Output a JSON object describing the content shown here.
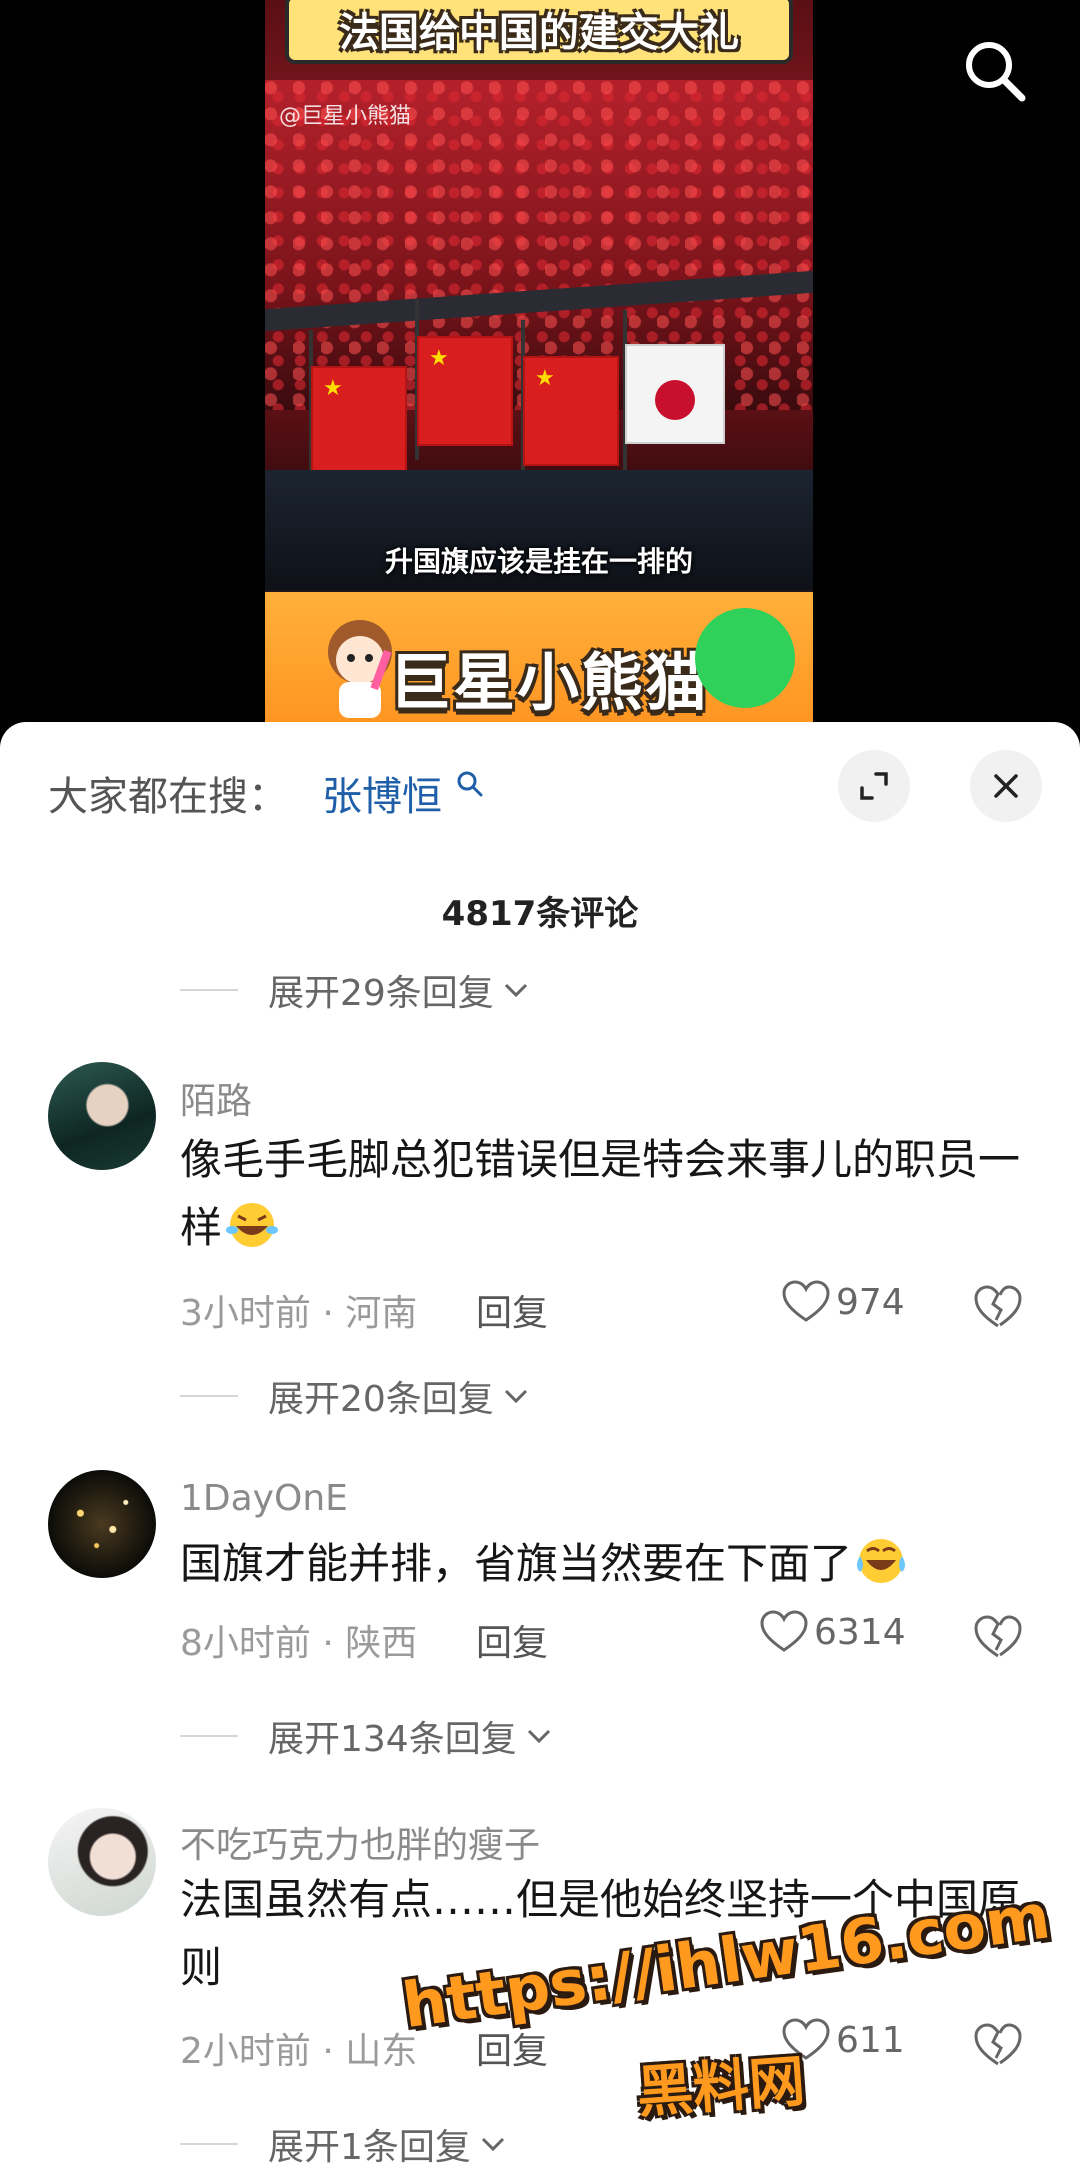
{
  "video": {
    "title_banner": "法国给中国的建交大礼",
    "watermark": "@巨星小熊猫",
    "subtitle": "升国旗应该是挂在一排的",
    "brand": "巨星小熊猫",
    "search_icon": "search-icon"
  },
  "sheet": {
    "hot_search_label": "大家都在搜：",
    "hot_search_term": "张博恒",
    "expand_icon": "expand-icon",
    "close_icon": "close-icon",
    "comment_count": "4817条评论"
  },
  "expanders": {
    "top": "展开29条回复",
    "after_comment_1": "展开20条回复",
    "after_comment_2": "展开134条回复",
    "after_comment_3": "展开1条回复"
  },
  "comments": [
    {
      "username": "陌路",
      "text": "像毛手毛脚总犯错误但是特会来事儿的职员一样",
      "emoji": "rolling-on-floor-laughing",
      "meta": "3小时前 · 河南",
      "reply_label": "回复",
      "likes": "974"
    },
    {
      "username": "1DayOnE",
      "text": "国旗才能并排，省旗当然要在下面了",
      "emoji": "crying-laughing",
      "meta": "8小时前 · 陕西",
      "reply_label": "回复",
      "likes": "6314"
    },
    {
      "username": "不吃巧克力也胖的瘦子",
      "text": "法国虽然有点……但是他始终坚持一个中国原则",
      "meta": "2小时前 · 山东",
      "reply_label": "回复",
      "likes": "611"
    }
  ],
  "site_watermark": {
    "line1": "https://ihlw16.com",
    "line2": "黑料网"
  },
  "colors": {
    "accent_link": "#1e5fa8",
    "sheet_bg": "#ffffff",
    "watermark_orange": "#ff9a1f"
  }
}
